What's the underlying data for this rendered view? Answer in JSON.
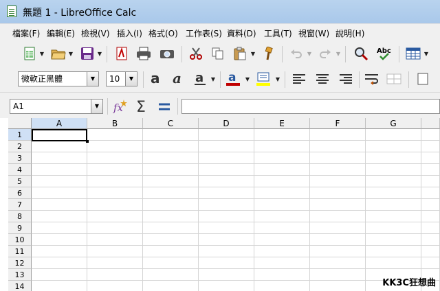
{
  "window": {
    "title": "無題 1 - LibreOffice Calc"
  },
  "menu": [
    {
      "label": "檔案(F)"
    },
    {
      "label": "編輯(E)"
    },
    {
      "label": "檢視(V)"
    },
    {
      "label": "插入(I)"
    },
    {
      "label": "格式(O)"
    },
    {
      "label": "工作表(S)"
    },
    {
      "label": "資料(D)"
    },
    {
      "label": "工具(T)"
    },
    {
      "label": "視窗(W)"
    },
    {
      "label": "說明(H)"
    }
  ],
  "toolbar_standard": {
    "icons": [
      "new-document-icon",
      "open-folder-icon",
      "save-icon",
      "export-pdf-icon",
      "print-icon",
      "print-preview-icon",
      "cut-icon",
      "copy-icon",
      "paste-icon",
      "clone-formatting-icon",
      "undo-icon",
      "redo-icon",
      "find-replace-icon",
      "spellcheck-icon",
      "grid-table-icon"
    ]
  },
  "toolbar_formatting": {
    "font_name": "微軟正黑體",
    "font_size": "10",
    "font_color": "#c00000",
    "highlight_color": "#ffff00"
  },
  "formula_bar": {
    "name_box": "A1",
    "formula": ""
  },
  "sheet": {
    "columns": [
      "A",
      "B",
      "C",
      "D",
      "E",
      "F",
      "G"
    ],
    "rows": [
      "1",
      "2",
      "3",
      "4",
      "5",
      "6",
      "7",
      "8",
      "9",
      "10",
      "11",
      "12",
      "13",
      "14"
    ],
    "selected_cell": "A1"
  },
  "watermark": "KK3C狂想曲"
}
